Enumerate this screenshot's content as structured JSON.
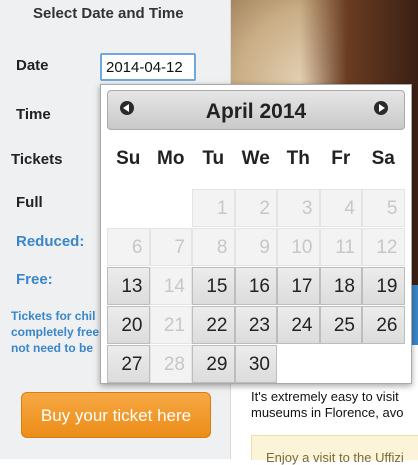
{
  "panel": {
    "title": "Select Date and Time",
    "date_label": "Date",
    "date_value": "2014-04-12",
    "time_label": "Time",
    "tickets_label": "Tickets",
    "full_label": "Full",
    "reduced_label": "Reduced:",
    "free_label": "Free:",
    "note_line1": "Tickets for chil",
    "note_line2": "completely free",
    "note_line3": "not need to be",
    "buy_button": "Buy your ticket here"
  },
  "content": {
    "line1": "It's extremely easy to visit",
    "line2": "museums in Florence, avo",
    "enjoy": "Enjoy a visit to the Uffizi"
  },
  "datepicker": {
    "title": "April 2014",
    "weekdays": [
      "Su",
      "Mo",
      "Tu",
      "We",
      "Th",
      "Fr",
      "Sa"
    ],
    "weeks": [
      [
        {
          "d": "",
          "s": "empty"
        },
        {
          "d": "",
          "s": "empty"
        },
        {
          "d": "1",
          "s": "disabled"
        },
        {
          "d": "2",
          "s": "disabled"
        },
        {
          "d": "3",
          "s": "disabled"
        },
        {
          "d": "4",
          "s": "disabled"
        },
        {
          "d": "5",
          "s": "disabled"
        }
      ],
      [
        {
          "d": "6",
          "s": "disabled"
        },
        {
          "d": "7",
          "s": "disabled"
        },
        {
          "d": "8",
          "s": "disabled"
        },
        {
          "d": "9",
          "s": "disabled"
        },
        {
          "d": "10",
          "s": "disabled"
        },
        {
          "d": "11",
          "s": "disabled"
        },
        {
          "d": "12",
          "s": "disabled"
        }
      ],
      [
        {
          "d": "13",
          "s": "active"
        },
        {
          "d": "14",
          "s": "disabled"
        },
        {
          "d": "15",
          "s": "active"
        },
        {
          "d": "16",
          "s": "active"
        },
        {
          "d": "17",
          "s": "active"
        },
        {
          "d": "18",
          "s": "active"
        },
        {
          "d": "19",
          "s": "active"
        }
      ],
      [
        {
          "d": "20",
          "s": "active"
        },
        {
          "d": "21",
          "s": "disabled"
        },
        {
          "d": "22",
          "s": "active"
        },
        {
          "d": "23",
          "s": "active"
        },
        {
          "d": "24",
          "s": "active"
        },
        {
          "d": "25",
          "s": "active"
        },
        {
          "d": "26",
          "s": "active"
        }
      ],
      [
        {
          "d": "27",
          "s": "active"
        },
        {
          "d": "28",
          "s": "disabled"
        },
        {
          "d": "29",
          "s": "active"
        },
        {
          "d": "30",
          "s": "active"
        },
        {
          "d": "",
          "s": "empty"
        },
        {
          "d": "",
          "s": "empty"
        },
        {
          "d": "",
          "s": "empty"
        }
      ]
    ],
    "prev_icon": "chevron-left-circle-icon",
    "next_icon": "chevron-right-circle-icon"
  },
  "colors": {
    "accent_blue": "#3a86c8",
    "button_orange": "#f09a2c"
  }
}
